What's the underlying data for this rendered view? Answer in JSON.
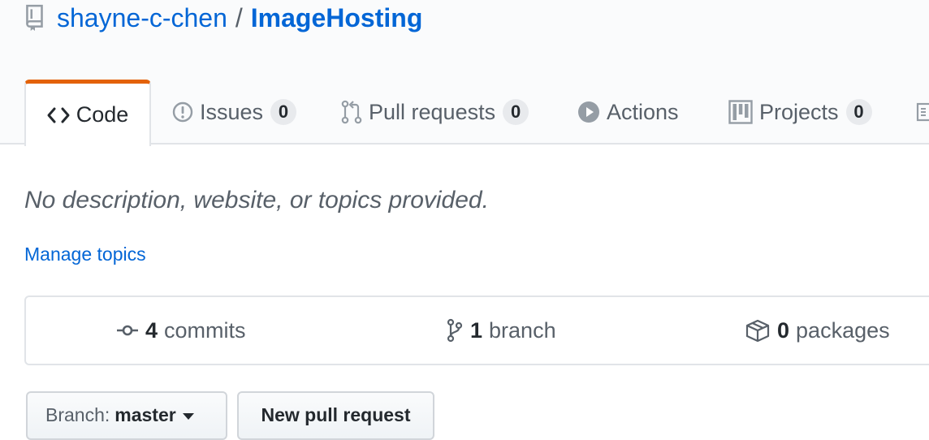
{
  "repo": {
    "owner": "shayne-c-chen",
    "separator": "/",
    "name": "ImageHosting"
  },
  "tabs": [
    {
      "label": "Code",
      "icon": "code-icon",
      "selected": true
    },
    {
      "label": "Issues",
      "icon": "issue-opened-icon",
      "count": "0"
    },
    {
      "label": "Pull requests",
      "icon": "git-pull-request-icon",
      "count": "0"
    },
    {
      "label": "Actions",
      "icon": "play-icon"
    },
    {
      "label": "Projects",
      "icon": "project-icon",
      "count": "0"
    },
    {
      "label": "",
      "icon": "book-icon"
    }
  ],
  "about": {
    "description": "No description, website, or topics provided.",
    "manage_topics": "Manage topics"
  },
  "stats": [
    {
      "count": "4",
      "label": "commits",
      "icon": "git-commit-icon"
    },
    {
      "count": "1",
      "label": "branch",
      "icon": "git-branch-icon"
    },
    {
      "count": "0",
      "label": "packages",
      "icon": "package-icon"
    }
  ],
  "controls": {
    "branch_label": "Branch:",
    "branch_value": "master",
    "new_pr": "New pull request"
  },
  "colors": {
    "link": "#0366d6",
    "selected_tab_accent": "#e36209",
    "muted_text": "#586069",
    "header_bg": "#fafbfc"
  }
}
